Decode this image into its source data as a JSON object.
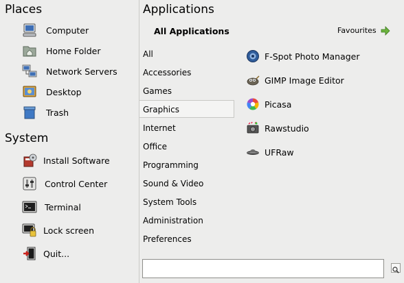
{
  "places": {
    "title": "Places",
    "items": [
      {
        "label": "Computer",
        "icon": "computer-icon"
      },
      {
        "label": "Home Folder",
        "icon": "home-folder-icon"
      },
      {
        "label": "Network Servers",
        "icon": "network-servers-icon"
      },
      {
        "label": "Desktop",
        "icon": "desktop-icon"
      },
      {
        "label": "Trash",
        "icon": "trash-icon"
      }
    ]
  },
  "system": {
    "title": "System",
    "items": [
      {
        "label": "Install Software",
        "icon": "install-software-icon"
      },
      {
        "label": "Control Center",
        "icon": "control-center-icon"
      },
      {
        "label": "Terminal",
        "icon": "terminal-icon"
      },
      {
        "label": "Lock screen",
        "icon": "lock-screen-icon"
      },
      {
        "label": "Quit...",
        "icon": "quit-icon"
      }
    ]
  },
  "applications": {
    "title": "Applications",
    "view_label": "All Applications",
    "favourites_label": "Favourites",
    "categories": [
      "All",
      "Accessories",
      "Games",
      "Graphics",
      "Internet",
      "Office",
      "Programming",
      "Sound & Video",
      "System Tools",
      "Administration",
      "Preferences"
    ],
    "selected_category": "Graphics",
    "apps": [
      {
        "label": "F-Spot Photo Manager",
        "icon": "f-spot-icon"
      },
      {
        "label": "GIMP Image Editor",
        "icon": "gimp-icon"
      },
      {
        "label": "Picasa",
        "icon": "picasa-icon"
      },
      {
        "label": "Rawstudio",
        "icon": "rawstudio-icon"
      },
      {
        "label": "UFRaw",
        "icon": "ufraw-icon"
      }
    ]
  },
  "search": {
    "value": "",
    "placeholder": ""
  },
  "colors": {
    "background": "#ededec",
    "favourites_arrow": "#6cb33e",
    "selected_category_bg": "#f4f4f3"
  }
}
